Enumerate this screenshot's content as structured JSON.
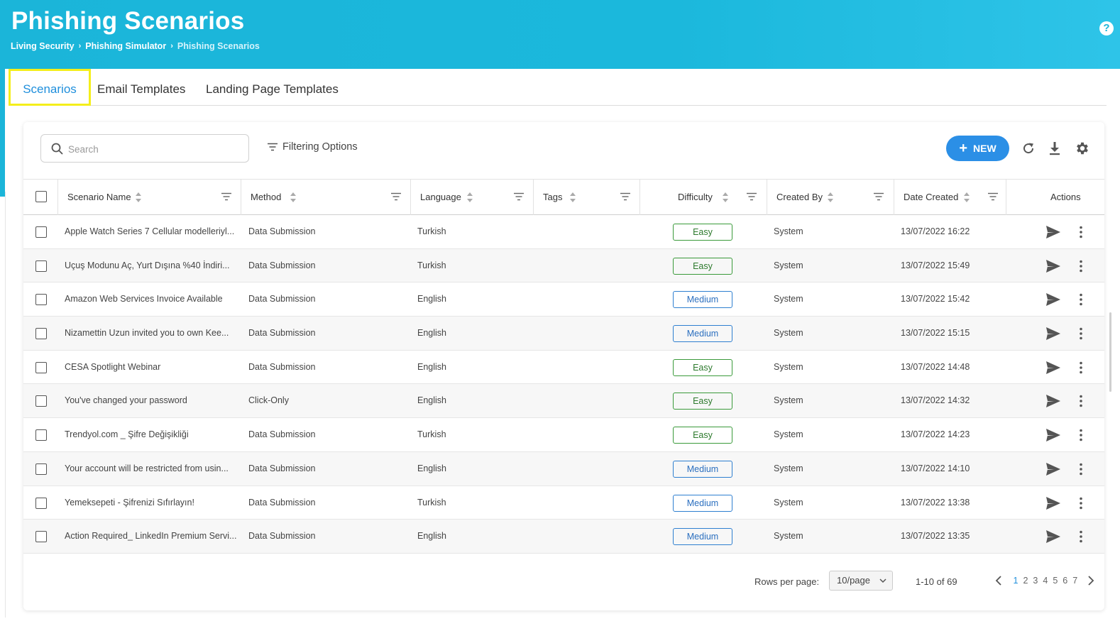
{
  "header": {
    "title": "Phishing Scenarios",
    "breadcrumb": [
      "Living Security",
      "Phishing Simulator",
      "Phishing Scenarios"
    ],
    "help_label": "?"
  },
  "tabs": [
    {
      "label": "Scenarios",
      "active": true
    },
    {
      "label": "Email Templates",
      "active": false
    },
    {
      "label": "Landing Page Templates",
      "active": false
    }
  ],
  "toolbar": {
    "search_placeholder": "Search",
    "filter_label": "Filtering Options",
    "new_label": "NEW",
    "icons": [
      "refresh-icon",
      "download-icon",
      "settings-icon"
    ]
  },
  "table": {
    "columns": [
      "Scenario Name",
      "Method",
      "Language",
      "Tags",
      "Difficulty",
      "Created By",
      "Date Created",
      "Actions"
    ],
    "rows": [
      {
        "name": "Apple Watch Series 7 Cellular modelleriyl...",
        "method": "Data Submission",
        "language": "Turkish",
        "tags": "",
        "difficulty": "Easy",
        "created_by": "System",
        "date": "13/07/2022 16:22"
      },
      {
        "name": "Uçuş Modunu Aç, Yurt Dışına %40 İndiri...",
        "method": "Data Submission",
        "language": "Turkish",
        "tags": "",
        "difficulty": "Easy",
        "created_by": "System",
        "date": "13/07/2022 15:49"
      },
      {
        "name": "Amazon Web Services Invoice Available",
        "method": "Data Submission",
        "language": "English",
        "tags": "",
        "difficulty": "Medium",
        "created_by": "System",
        "date": "13/07/2022 15:42"
      },
      {
        "name": "Nizamettin Uzun invited you to own Kee...",
        "method": "Data Submission",
        "language": "English",
        "tags": "",
        "difficulty": "Medium",
        "created_by": "System",
        "date": "13/07/2022 15:15"
      },
      {
        "name": "CESA Spotlight Webinar",
        "method": "Data Submission",
        "language": "English",
        "tags": "",
        "difficulty": "Easy",
        "created_by": "System",
        "date": "13/07/2022 14:48"
      },
      {
        "name": "You've changed your password",
        "method": "Click-Only",
        "language": "English",
        "tags": "",
        "difficulty": "Easy",
        "created_by": "System",
        "date": "13/07/2022 14:32"
      },
      {
        "name": "Trendyol.com _ Şifre Değişikliği",
        "method": "Data Submission",
        "language": "Turkish",
        "tags": "",
        "difficulty": "Easy",
        "created_by": "System",
        "date": "13/07/2022 14:23"
      },
      {
        "name": "Your account will be restricted from usin...",
        "method": "Data Submission",
        "language": "English",
        "tags": "",
        "difficulty": "Medium",
        "created_by": "System",
        "date": "13/07/2022 14:10"
      },
      {
        "name": "Yemeksepeti - Şifrenizi Sıfırlayın!",
        "method": "Data Submission",
        "language": "Turkish",
        "tags": "",
        "difficulty": "Medium",
        "created_by": "System",
        "date": "13/07/2022 13:38"
      },
      {
        "name": "Action Required_ LinkedIn Premium Servi...",
        "method": "Data Submission",
        "language": "English",
        "tags": "",
        "difficulty": "Medium",
        "created_by": "System",
        "date": "13/07/2022 13:35"
      }
    ]
  },
  "pagination": {
    "rows_per_page_label": "Rows per page:",
    "rows_per_page_value": "10/page",
    "range_text": "1-10 of 69",
    "pages": [
      "1",
      "2",
      "3",
      "4",
      "5",
      "6",
      "7"
    ],
    "current_page": "1"
  },
  "colors": {
    "header_bg": "#1bb5d9",
    "accent": "#2b8fe6",
    "active_tab_text": "#1f8fdc",
    "highlight_border": "#f4ee1b",
    "easy": "#3a9a3a",
    "medium": "#2e7fd0"
  }
}
